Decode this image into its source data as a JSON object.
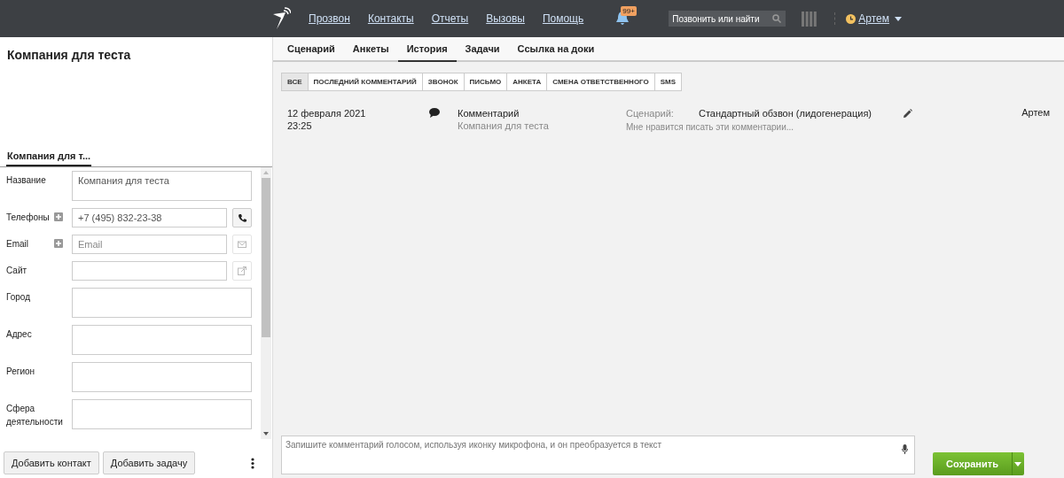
{
  "topbar": {
    "nav": [
      "Прозвон",
      "Контакты",
      "Отчеты",
      "Вызовы",
      "Помощь"
    ],
    "notifications_badge": "99+",
    "search": {
      "placeholder": "Позвонить или найти"
    },
    "user": "Артем"
  },
  "card": {
    "title": "Компания для теста",
    "tabs": [
      {
        "label": "Компания для т...",
        "selected": true
      }
    ],
    "fields": [
      {
        "label": "Название",
        "kind": "textarea",
        "value": "Компания для теста"
      },
      {
        "label": "Телефоны",
        "kind": "input",
        "add": true,
        "value": "+7 (495) 832-23-38",
        "action": {
          "kind": "phone",
          "enabled": true
        }
      },
      {
        "label": "Email",
        "kind": "input",
        "add": true,
        "placeholder": "Email",
        "action": {
          "kind": "mail",
          "enabled": false
        }
      },
      {
        "label": "Сайт",
        "kind": "input",
        "action": {
          "kind": "link",
          "enabled": false
        }
      },
      {
        "label": "Город",
        "kind": "textarea"
      },
      {
        "label": "Адрес",
        "kind": "textarea"
      },
      {
        "label": "Регион",
        "kind": "textarea"
      },
      {
        "label": "Сфера деятельности",
        "kind": "textarea"
      }
    ],
    "buttons": [
      "Добавить контакт",
      "Добавить задачу"
    ]
  },
  "main": {
    "tabs": [
      {
        "label": "Сценарий",
        "selected": false
      },
      {
        "label": "Анкеты",
        "selected": false
      },
      {
        "label": "История",
        "selected": true
      },
      {
        "label": "Задачи",
        "selected": false
      },
      {
        "label": "Ссылка на доки",
        "selected": false
      }
    ],
    "filters": [
      {
        "label": "ВСЕ",
        "selected": true
      },
      {
        "label": "ПОСЛЕДНИЙ КОММЕНТАРИЙ",
        "selected": false
      },
      {
        "label": "ЗВОНОК",
        "selected": false
      },
      {
        "label": "ПИСЬМО",
        "selected": false
      },
      {
        "label": "АНКЕТА",
        "selected": false
      },
      {
        "label": "СМЕНА ОТВЕТСТВЕННОГО",
        "selected": false
      },
      {
        "label": "SMS",
        "selected": false
      }
    ],
    "history": [
      {
        "date": "12 февраля 2021",
        "time": "23:25",
        "type": "Комментарий",
        "company": "Компания для теста",
        "scenario_label": "Сценарий:",
        "scenario": "Стандартный обзвон (лидогенерация)",
        "comment": "Мне нравится писать эти комментарии...",
        "user": "Артем"
      }
    ],
    "comment": {
      "placeholder": "Запишите комментарий голосом, используя иконку микрофона, и он преобразуется в текст"
    },
    "save_button": "Сохранить"
  }
}
